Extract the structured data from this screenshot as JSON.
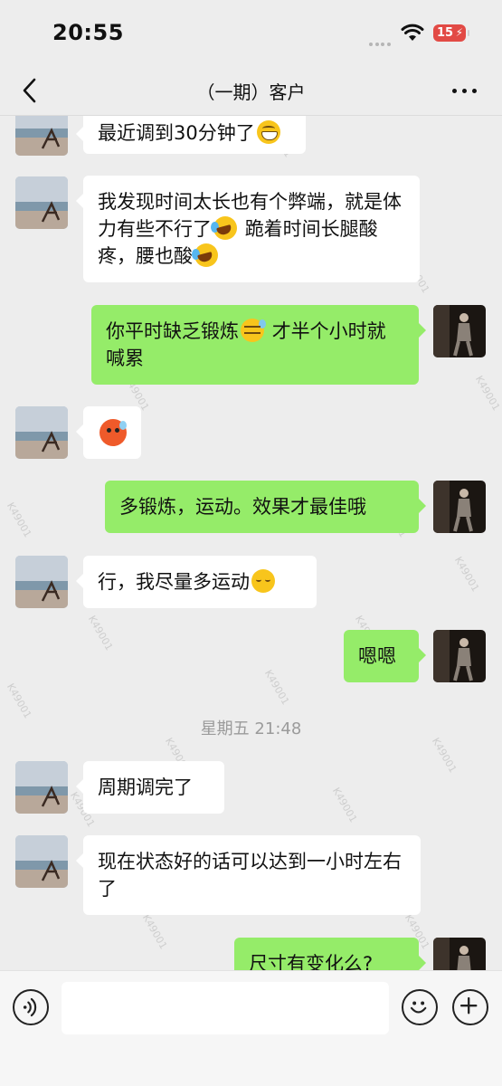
{
  "status_bar": {
    "time": "20:55",
    "battery": "15"
  },
  "header": {
    "title": "（一期）客户",
    "back_icon": "chevron-left-icon",
    "more_icon": "more-dots-icon"
  },
  "messages": [
    {
      "side": "in",
      "text": "最近调到30分钟了",
      "emoji_after": "grin"
    },
    {
      "side": "in",
      "text": "我发现时间太长也有个弊端，就是体力有些不行了",
      "mid_emoji": "laughcry",
      "text2": "跪着时间长腿酸疼，腰也酸",
      "emoji_after": "laughcry"
    },
    {
      "side": "out",
      "text": "你平时缺乏锻炼",
      "mid_emoji": "cool",
      "text2": "才半个小时就喊累"
    },
    {
      "side": "in",
      "emoji_only": "sweat"
    },
    {
      "side": "out",
      "text": "多锻炼，运动。效果才最佳哦"
    },
    {
      "side": "in",
      "text": "行，我尽量多运动",
      "emoji_after": "relieved"
    },
    {
      "side": "out",
      "text": "嗯嗯"
    },
    {
      "side": "in",
      "text": "周期调完了"
    },
    {
      "side": "in",
      "text": "现在状态好的话可以达到一小时左右了"
    },
    {
      "side": "out",
      "text": "尺寸有变化么?"
    }
  ],
  "timestamp": "星期五 21:48",
  "watermark": "K49001",
  "input_bar": {
    "placeholder": "",
    "voice_icon": "voice-icon",
    "emoji_icon": "smiley-icon",
    "plus_icon": "plus-icon"
  },
  "colors": {
    "background": "#ededed",
    "incoming_bubble": "#ffffff",
    "outgoing_bubble": "#95ec69",
    "battery": "#e24a45"
  }
}
